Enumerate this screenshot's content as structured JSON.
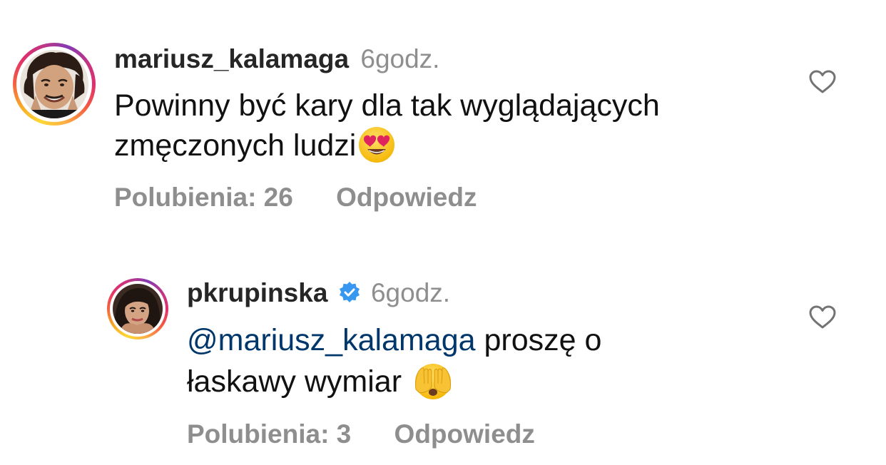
{
  "comments": [
    {
      "username": "mariusz_kalamaga",
      "time": "6godz.",
      "verified": false,
      "text_line1": "Powinny być kary dla tak wyglądających",
      "text_line2": "zmęczonych ludzi",
      "emoji": "smiling-face-with-heart-eyes",
      "likes_label": "Polubienia: 26",
      "reply_label": "Odpowiedz"
    },
    {
      "username": "pkrupinska",
      "time": "6godz.",
      "verified": true,
      "mention": "@mariusz_kalamaga",
      "text_line1_rest": "proszę o",
      "text_line2": "łaskawy wymiar",
      "emoji": "face-with-hands-over-eyes",
      "likes_label": "Polubienia: 3",
      "reply_label": "Odpowiedz"
    }
  ],
  "colors": {
    "username": "#262626",
    "meta": "#8e8e8e",
    "mention": "#00376b",
    "verified": "#3897f0"
  }
}
